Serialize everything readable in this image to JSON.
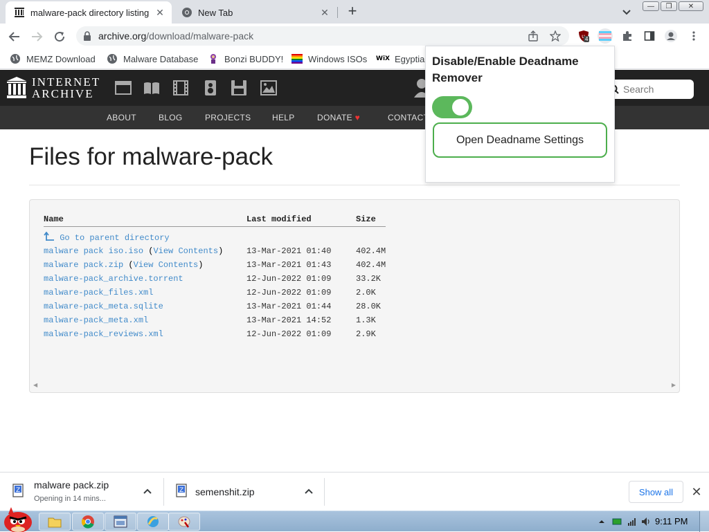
{
  "browser": {
    "tabs": [
      {
        "title": "malware-pack directory listing",
        "active": true,
        "icon": "archive-icon"
      },
      {
        "title": "New Tab",
        "active": false,
        "icon": "chrome-icon"
      }
    ],
    "url_host": "archive.org",
    "url_path": "/download/malware-pack",
    "extension_badge": "4"
  },
  "bookmarks": [
    {
      "label": "MEMZ Download",
      "icon": "globe-icon"
    },
    {
      "label": "Malware Database",
      "icon": "globe-icon"
    },
    {
      "label": "Bonzi BUDDY!",
      "icon": "bonzi-icon"
    },
    {
      "label": "Windows ISOs",
      "icon": "rainbow-flag-icon"
    },
    {
      "label": "Egyptian",
      "icon": "wix-icon"
    }
  ],
  "ia": {
    "logo_line1": "INTERNET",
    "logo_line2": "ARCHIVE",
    "search_placeholder": "Search",
    "nav": [
      "ABOUT",
      "BLOG",
      "PROJECTS",
      "HELP",
      "DONATE",
      "CONTACT"
    ]
  },
  "page": {
    "title": "Files for malware-pack",
    "columns": {
      "name": "Name",
      "modified": "Last modified",
      "size": "Size"
    },
    "parent_link": "Go to parent directory",
    "files": [
      {
        "name": "malware pack iso.iso",
        "extra": "View Contents",
        "modified": "13-Mar-2021 01:40",
        "size": "402.4M"
      },
      {
        "name": "malware pack.zip",
        "extra": "View Contents",
        "modified": "13-Mar-2021 01:43",
        "size": "402.4M"
      },
      {
        "name": "malware-pack_archive.torrent",
        "extra": "",
        "modified": "12-Jun-2022 01:09",
        "size": "33.2K"
      },
      {
        "name": "malware-pack_files.xml",
        "extra": "",
        "modified": "12-Jun-2022 01:09",
        "size": "2.0K"
      },
      {
        "name": "malware-pack_meta.sqlite",
        "extra": "",
        "modified": "13-Mar-2021 01:44",
        "size": "28.0K"
      },
      {
        "name": "malware-pack_meta.xml",
        "extra": "",
        "modified": "13-Mar-2021 14:52",
        "size": "1.3K"
      },
      {
        "name": "malware-pack_reviews.xml",
        "extra": "",
        "modified": "12-Jun-2022 01:09",
        "size": "2.9K"
      }
    ]
  },
  "popup": {
    "title": "Disable/Enable Deadname Remover",
    "toggle_on": true,
    "button": "Open Deadname Settings",
    "accent": "#5cb85c"
  },
  "downloads": [
    {
      "name": "malware pack.zip",
      "status": "Opening in 14 mins..."
    },
    {
      "name": "semenshit.zip",
      "status": ""
    }
  ],
  "downloads_show_all": "Show all",
  "taskbar": {
    "clock": "9:11 PM"
  }
}
